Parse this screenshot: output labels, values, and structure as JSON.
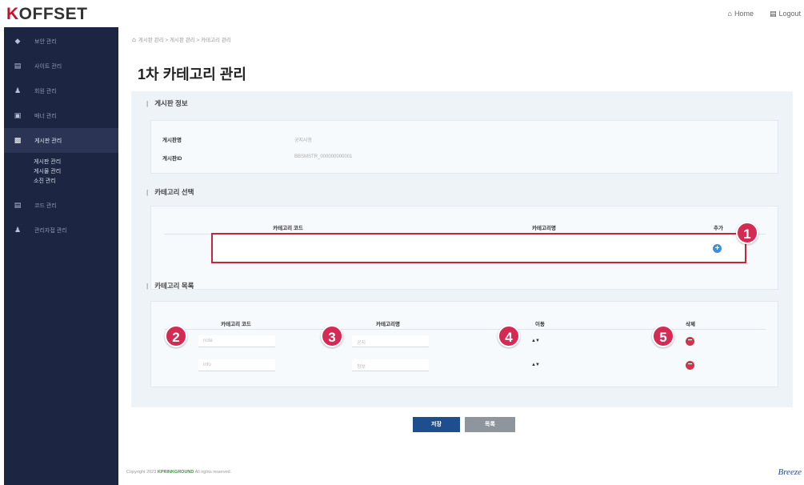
{
  "header": {
    "logo_first": "K",
    "logo_rest": "OFFSET",
    "home_label": "Home",
    "logout_label": "Logout"
  },
  "sidebar": {
    "items": [
      {
        "label": "보안 관리",
        "icon": "shield-icon"
      },
      {
        "label": "사이트 관리",
        "icon": "document-icon"
      },
      {
        "label": "회원 관리",
        "icon": "user-icon"
      },
      {
        "label": "배너 관리",
        "icon": "banner-icon"
      },
      {
        "label": "게시판 관리",
        "icon": "board-icon",
        "active": true
      },
      {
        "label": "코드 관리",
        "icon": "code-icon"
      },
      {
        "label": "관리자접 관리",
        "icon": "admin-icon"
      }
    ],
    "sub_items": [
      "게시판 관리",
      "게시물 관리",
      "소진 관리"
    ]
  },
  "breadcrumb": "게시판 관리 > 게시판 관리 > 카테고리 관리",
  "page_title": "1차 카테고리 관리",
  "board_info": {
    "section_title": "게시판 정보",
    "name_label": "게시판명",
    "name_value": "공지사항",
    "id_label": "게시판ID",
    "id_value": "BBSMSTR_000000000001"
  },
  "category_select": {
    "section_title": "카테고리 선택",
    "col_code": "카테고리 코드",
    "col_name": "카테고리명",
    "col_add": "추가"
  },
  "category_list": {
    "section_title": "카테고리 목록",
    "col_code": "카테고리 코드",
    "col_name": "카테고리명",
    "col_move": "이동",
    "col_delete": "삭제",
    "rows": [
      {
        "code": "note",
        "name": "공지"
      },
      {
        "code": "info",
        "name": "정보"
      }
    ]
  },
  "markers": [
    "1",
    "2",
    "3",
    "4",
    "5"
  ],
  "buttons": {
    "save": "저장",
    "list": "목록"
  },
  "footer": {
    "prefix": "Copyright 2023 ",
    "brand": "KPRINKGROUND",
    "suffix": " All rights reserved."
  },
  "corner_logo": "Breeze",
  "colors": {
    "sidebar_bg": "#1c2541",
    "accent_red": "#c8243a",
    "badge": "#d42b55",
    "save_btn": "#1d4f8f",
    "list_btn": "#8e959d",
    "add_btn": "#3b8fd8"
  }
}
